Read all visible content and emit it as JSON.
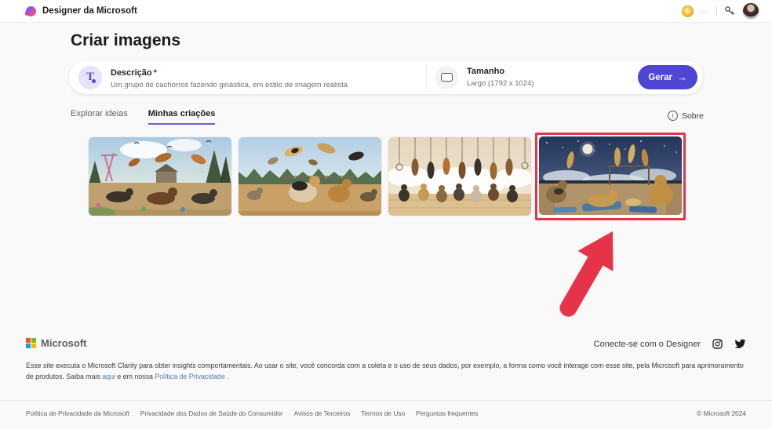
{
  "header": {
    "app_title": "Designer da Microsoft",
    "credits_more": "..."
  },
  "main": {
    "page_title": "Criar imagens",
    "prompt_card": {
      "description_label": "Descrição",
      "required_marker": "*",
      "description_value": "Um grupo de cachorros fazendo ginástica, em estilo de imagem realista",
      "size_label": "Tamanho",
      "size_value": "Largo (1792 x 1024)",
      "generate_label": "Gerar",
      "generate_arrow": "→"
    },
    "tabs": [
      {
        "label": "Explorar ideias",
        "active": false
      },
      {
        "label": "Minhas criações",
        "active": true
      }
    ],
    "about_label": "Sobre",
    "gallery": {
      "image_count": 4,
      "highlighted_index": 3
    }
  },
  "footer": {
    "microsoft_label": "Microsoft",
    "connect_label": "Conecte-se com o Designer",
    "privacy_notice": {
      "text_before": "Esse site executa o Microsoft Clarity para obter insights comportamentais. Ao usar o site, você concorda com a coleta e o uso de seus dados, por exemplo, a forma como você interage com esse site, pela Microsoft para aprimoramento de produtos. Saiba mais",
      "link_here": "aqui",
      "text_middle": "e em nossa",
      "link_privacy": "Política de Privacidade",
      "text_after": "."
    },
    "links": [
      "Política de Privacidade da Microsoft",
      "Privacidade dos Dados de Saúde do Consumidor",
      "Avisos de Terceiros",
      "Termos de Uso",
      "Perguntas frequentes"
    ],
    "copyright": "© Microsoft 2024"
  },
  "colors": {
    "accent_indigo": "#4f46d3",
    "tab_underline_purple": "#6a5fd0",
    "annotation_red": "#e5344a",
    "link_blue": "#4a7db5",
    "coin_gold": "#f2b632"
  }
}
